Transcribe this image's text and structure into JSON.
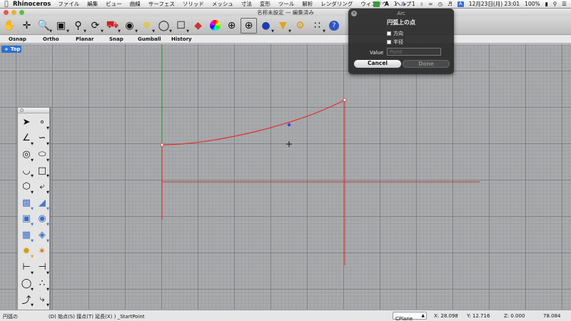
{
  "menubar": {
    "app_name": "Rhinoceros",
    "menus": [
      "ファイル",
      "編集",
      "ビュー",
      "曲線",
      "サーフェス",
      "ソリッド",
      "メッシュ",
      "寸法",
      "変形",
      "ツール",
      "解析",
      "レンダリング",
      "ウィンドウ",
      "ヘルプ"
    ],
    "status_a1": "1",
    "status_a2": "1",
    "datetime": "12月23日(月)  23:01",
    "battery": "100%"
  },
  "window": {
    "title": "名称未設定 — 編集済み"
  },
  "toolbar": {
    "icons": [
      "pan-hand-icon",
      "move-cross-icon",
      "zoom-window-icon",
      "zoom-extents-icon",
      "zoom-selected-icon",
      "rotate-view-icon",
      "named-view-car-icon",
      "hide-eye-icon",
      "light-bulb-icon",
      "lightbulb-off-icon",
      "lock-icon",
      "material-icon",
      "color-wheel-icon",
      "wireframe-sphere-icon",
      "shaded-sphere-icon",
      "rendered-sphere-icon",
      "filter-icon",
      "gears-icon",
      "grid-points-icon",
      "help-icon"
    ]
  },
  "snapbar": {
    "items": [
      "Osnap",
      "Ortho",
      "Planar",
      "Snap",
      "Gumball",
      "History"
    ]
  },
  "viewport": {
    "label": "Top"
  },
  "dialog": {
    "title": "Arc",
    "prompt": "円弧上の点",
    "option_direction": "方向",
    "option_radius": "半径",
    "value_label": "Value",
    "value_placeholder": "Point",
    "cancel_label": "Cancel",
    "done_label": "Done"
  },
  "statusbar": {
    "command_prompt": "円弧の",
    "command_options": "(D) 始点(S) 接点(T) 延長(X) ) _StartPoint",
    "cplane": "CPlane",
    "x": "X: 28.098",
    "y": "Y: 12.716",
    "z": "Z: 0.000",
    "distance": "78.084"
  },
  "colors": {
    "curve": "#e23030",
    "y_axis": "#3aa63a",
    "x_axis": "#b83a3a",
    "dialog_bg": "#2a2a2a",
    "viewport_tab": "#2f6fd0"
  }
}
